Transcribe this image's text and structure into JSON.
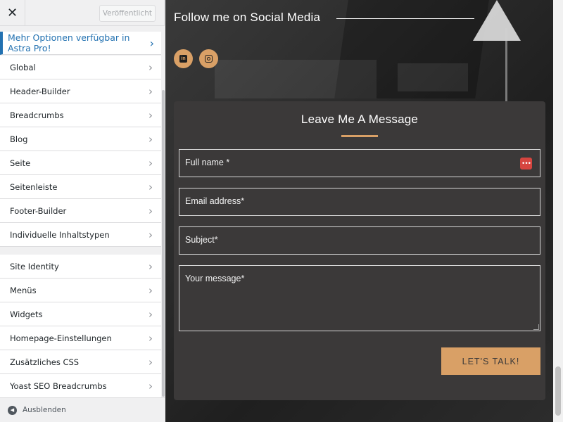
{
  "sidebar": {
    "close_label": "✕",
    "publish_label": "Veröffentlicht",
    "promo_label": "Mehr Optionen verfügbar in Astra Pro!",
    "group1": [
      {
        "label": "Global"
      },
      {
        "label": "Header-Builder"
      },
      {
        "label": "Breadcrumbs"
      },
      {
        "label": "Blog"
      },
      {
        "label": "Seite"
      },
      {
        "label": "Seitenleiste"
      },
      {
        "label": "Footer-Builder"
      },
      {
        "label": "Individuelle Inhaltstypen"
      }
    ],
    "group2": [
      {
        "label": "Site Identity"
      },
      {
        "label": "Menüs"
      },
      {
        "label": "Widgets"
      },
      {
        "label": "Homepage-Einstellungen"
      },
      {
        "label": "Zusätzliches CSS"
      },
      {
        "label": "Yoast SEO Breadcrumbs"
      }
    ],
    "collapse_label": "Ausblenden",
    "chevron_glyph": "›"
  },
  "preview": {
    "social_title": "Follow me on Social Media",
    "icons": [
      "linkedin-icon",
      "instagram-icon"
    ],
    "form": {
      "title": "Leave Me A Message",
      "fields": {
        "full_name": "Full name *",
        "email": "Email address*",
        "subject": "Subject*",
        "message": "Your message*"
      },
      "submit_label": "LET'S TALK!"
    },
    "colors": {
      "accent": "#d9a066",
      "card": "#3b3939",
      "link": "#2271b1"
    }
  }
}
